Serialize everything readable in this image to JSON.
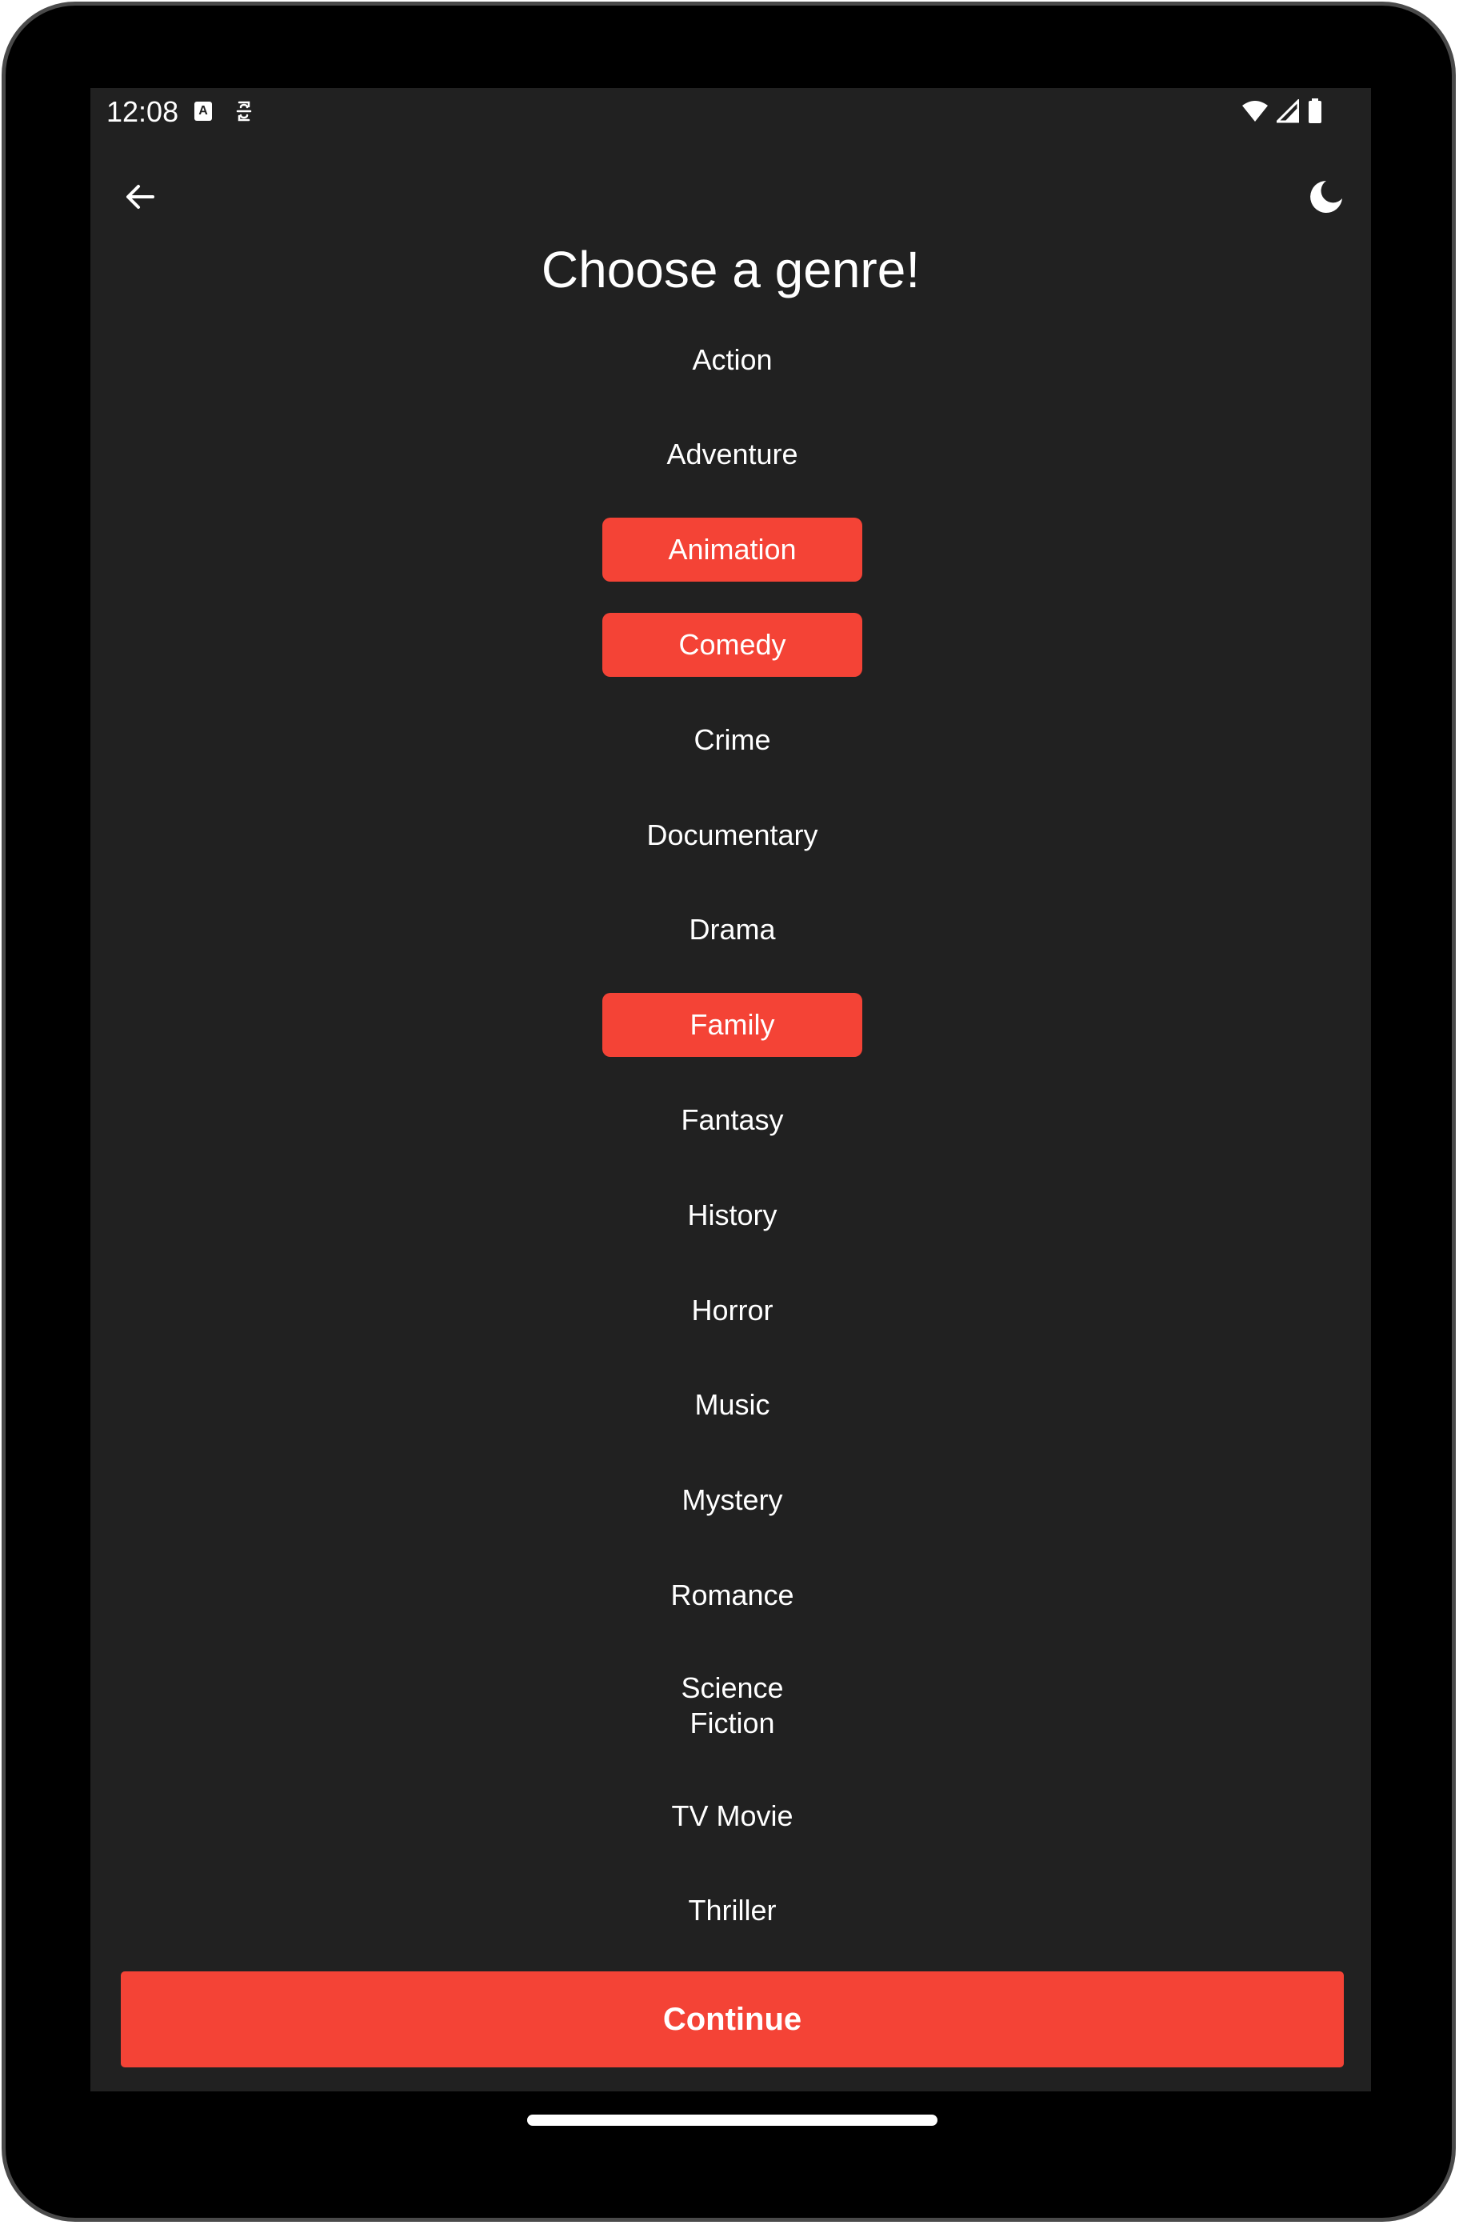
{
  "status_bar": {
    "time": "12:08",
    "a_badge": "A",
    "icons": [
      "wifi-icon",
      "cellular-signal-icon",
      "battery-icon"
    ]
  },
  "toolbar": {
    "back_icon": "arrow-left-icon",
    "theme_icon": "moon-icon"
  },
  "page": {
    "title": "Choose a genre!"
  },
  "genres": [
    {
      "label": "Action",
      "selected": false
    },
    {
      "label": "Adventure",
      "selected": false
    },
    {
      "label": "Animation",
      "selected": true
    },
    {
      "label": "Comedy",
      "selected": true
    },
    {
      "label": "Crime",
      "selected": false
    },
    {
      "label": "Documentary",
      "selected": false
    },
    {
      "label": "Drama",
      "selected": false
    },
    {
      "label": "Family",
      "selected": true
    },
    {
      "label": "Fantasy",
      "selected": false
    },
    {
      "label": "History",
      "selected": false
    },
    {
      "label": "Horror",
      "selected": false
    },
    {
      "label": "Music",
      "selected": false
    },
    {
      "label": "Mystery",
      "selected": false
    },
    {
      "label": "Romance",
      "selected": false
    },
    {
      "label": "Science\nFiction",
      "selected": false
    },
    {
      "label": "TV Movie",
      "selected": false
    },
    {
      "label": "Thriller",
      "selected": false
    }
  ],
  "continue_label": "Continue",
  "colors": {
    "accent": "#f44336",
    "background": "#212121",
    "text": "#ffffff"
  }
}
